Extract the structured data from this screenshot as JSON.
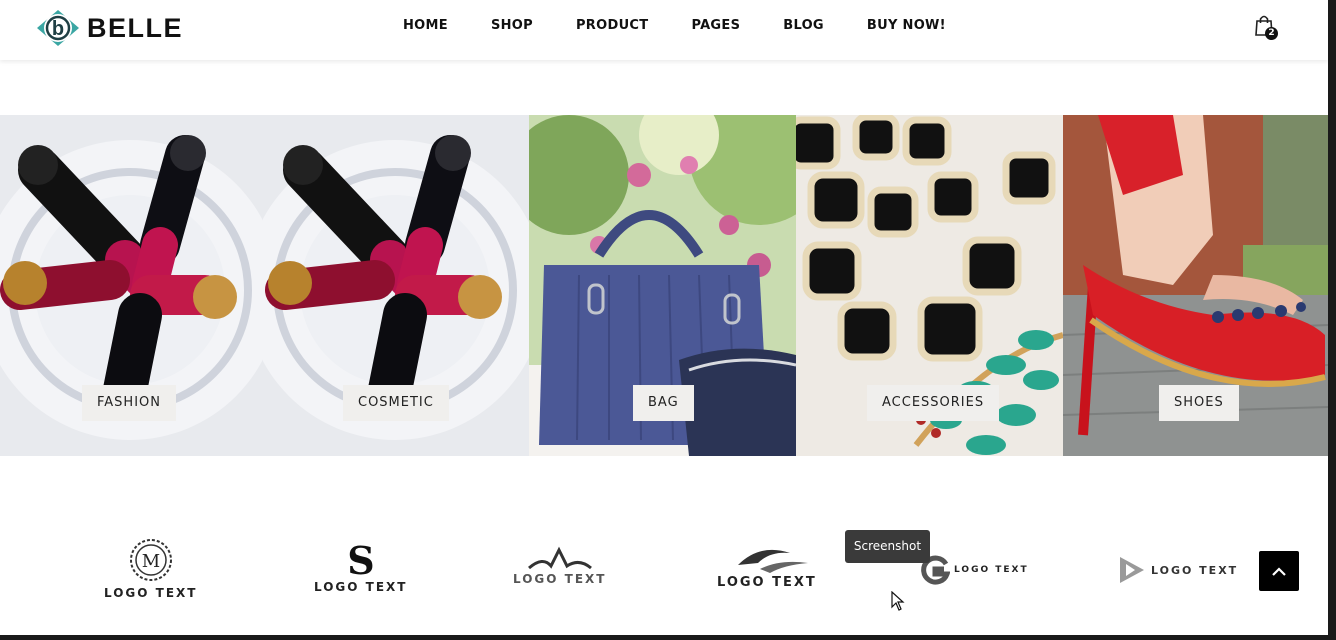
{
  "header": {
    "logo_letter": "b",
    "logo_text": "BELLE",
    "nav": [
      "HOME",
      "SHOP",
      "PRODUCT",
      "PAGES",
      "BLOG",
      "BUY NOW!"
    ],
    "cart_icon": "shopping-bag-icon",
    "cart_count": "2"
  },
  "categories": [
    {
      "label": "FASHION",
      "image": "lipsticks"
    },
    {
      "label": "COSMETIC",
      "image": "lipsticks"
    },
    {
      "label": "BAG",
      "image": "handbag"
    },
    {
      "label": "ACCESSORIES",
      "image": "necklace"
    },
    {
      "label": "SHOES",
      "image": "red-sandal"
    }
  ],
  "brands": [
    {
      "text": "LOGO TEXT",
      "mark": "M"
    },
    {
      "text": "LOGO TEXT",
      "mark": "S"
    },
    {
      "text": "LOGO TEXT",
      "mark": "wave"
    },
    {
      "text": "LOGO TEXT",
      "mark": "swoosh"
    },
    {
      "text": "LOGO TEXT",
      "mark": "G"
    },
    {
      "text": "LOGO TEXT",
      "mark": "play"
    }
  ],
  "tooltip": "Screenshot",
  "back_to_top_icon": "chevron-up-icon",
  "colors": {
    "accent": "#3aa6a3",
    "label_bg": "#f0efed",
    "text": "#111111"
  }
}
